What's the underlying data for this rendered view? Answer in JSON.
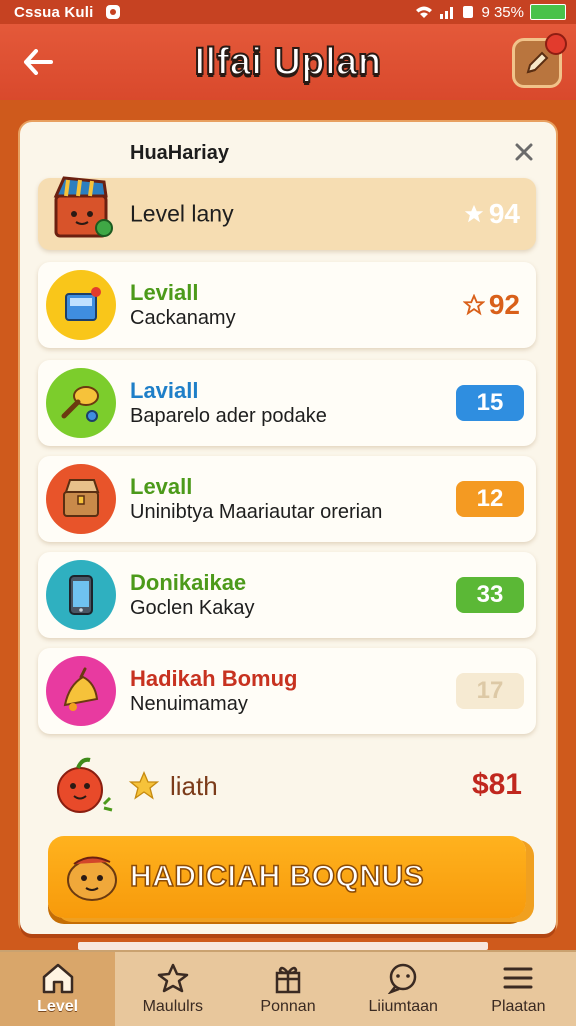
{
  "status_bar": {
    "carrier": "Cssua Kuli",
    "battery_text": "9 35%"
  },
  "header": {
    "title": "Ilfai Uplan"
  },
  "card": {
    "title": "HuaHariay",
    "rows": [
      {
        "label": "Level lany",
        "score": "94",
        "score_color": "#ffffff"
      },
      {
        "label_top": "Leviall",
        "label_bottom": "Cackanamy",
        "score": "92",
        "label_top_color": "#4c9a1a",
        "score_color": "#d9601a"
      },
      {
        "label_top": "Laviall",
        "label_bottom": "Baparelo ader podake",
        "value": "15",
        "label_top_color": "#1f7fc8",
        "pill_color": "#2f8ee0"
      },
      {
        "label_top": "Levall",
        "label_bottom": "Uninibtya Maariautar orerian",
        "value": "12",
        "label_top_color": "#4c9a1a",
        "pill_color": "#f49a22"
      },
      {
        "label_top": "Donikaikae",
        "label_bottom": "Goclen Kakay",
        "value": "33",
        "label_top_color": "#4c9a1a",
        "pill_color": "#5bb836"
      },
      {
        "label_top": "Hadikah Bomug",
        "label_bottom": "Nenuimamay",
        "value": "17",
        "label_top_color": "#c73220",
        "pill_color": "#f6ead2"
      }
    ],
    "summary": {
      "text": "liath",
      "amount": "$81"
    },
    "bonus_button": "HADICIAH BOQNUS"
  },
  "bottom_nav": [
    {
      "label": "Level",
      "icon": "home-icon"
    },
    {
      "label": "Maululrs",
      "icon": "star-icon"
    },
    {
      "label": "Ponnan",
      "icon": "gift-icon"
    },
    {
      "label": "Liiumtaan",
      "icon": "chat-icon"
    },
    {
      "label": "Plaatan",
      "icon": "menu-icon"
    }
  ]
}
